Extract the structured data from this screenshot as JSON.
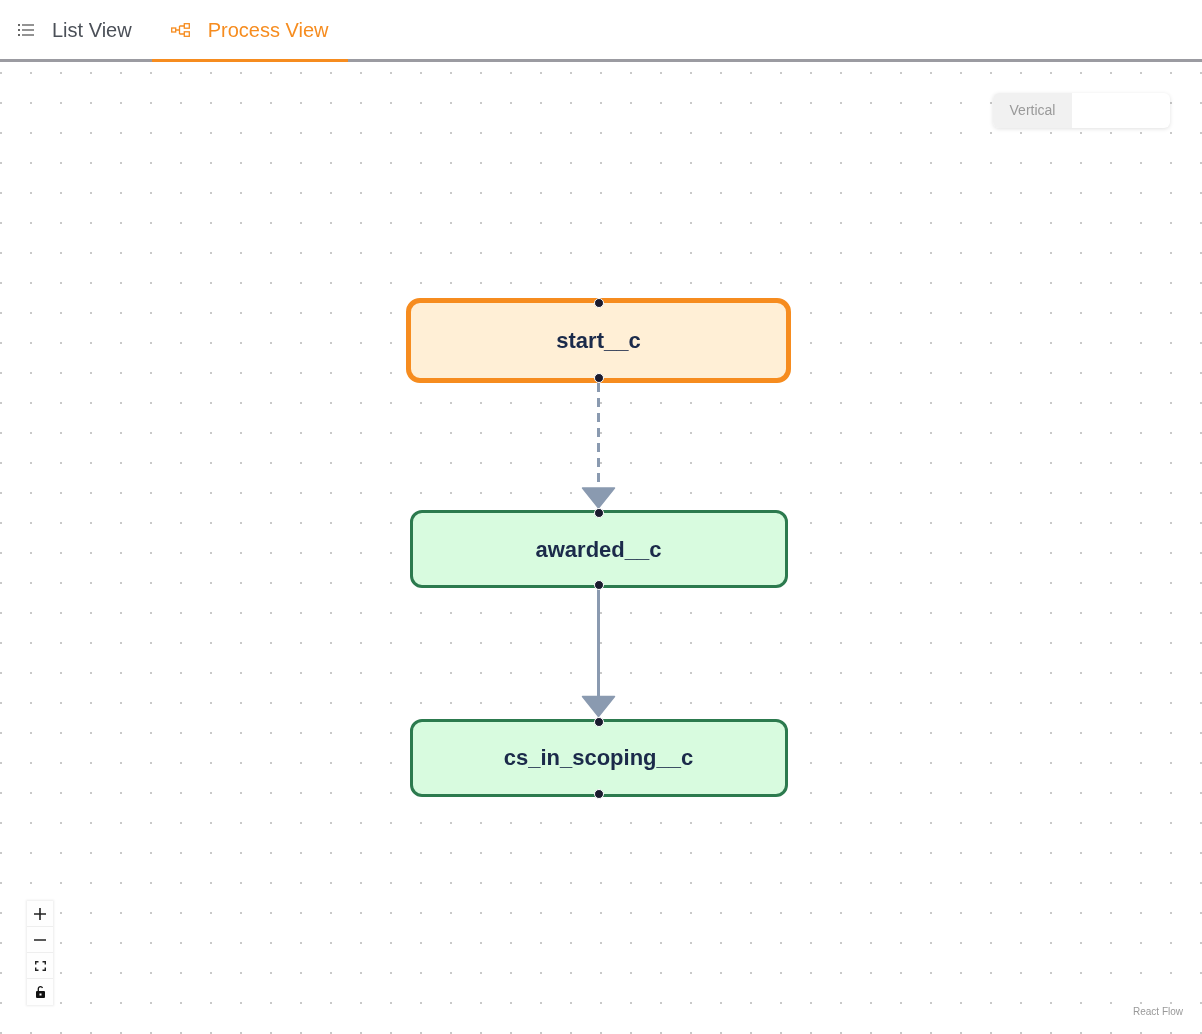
{
  "tabs": [
    {
      "label": "List View",
      "selected": false
    },
    {
      "label": "Process View",
      "selected": true
    }
  ],
  "layout_toggle": {
    "options": [
      {
        "label": "Vertical",
        "selected": true
      }
    ]
  },
  "canvas": {
    "nodes": [
      {
        "label": "start__c",
        "kind": "start"
      },
      {
        "label": "awarded__c",
        "kind": "state"
      },
      {
        "label": "cs_in_scoping__c",
        "kind": "state"
      }
    ],
    "edges": [
      {
        "kind": "dashed"
      },
      {
        "kind": "solid"
      }
    ]
  },
  "attribution": "React Flow"
}
